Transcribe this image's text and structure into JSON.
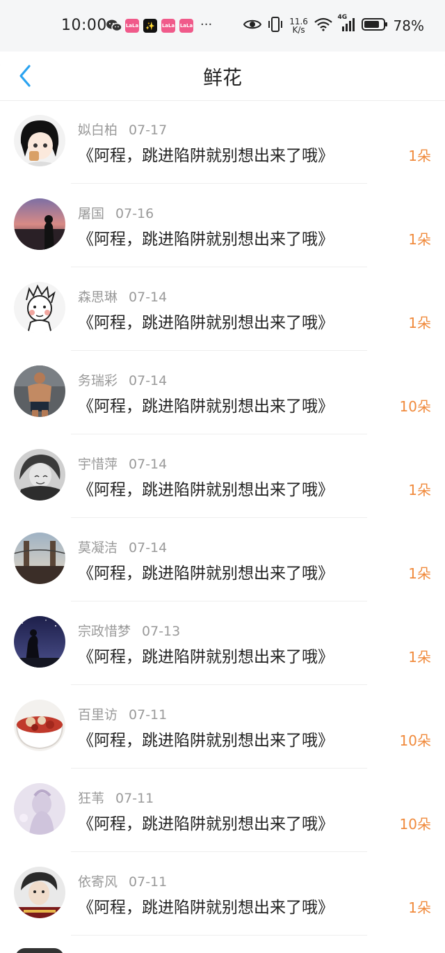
{
  "status_bar": {
    "time": "10:00",
    "notifications": [
      {
        "icon": "wechat-icon"
      },
      {
        "icon": "app-icon",
        "label": "LaLa"
      },
      {
        "icon": "app-icon-dark",
        "label": "✨"
      },
      {
        "icon": "app-icon",
        "label": "LaLa"
      },
      {
        "icon": "app-icon",
        "label": "LaLa"
      }
    ],
    "more": "···",
    "net_speed": "11.6",
    "net_speed_unit": "K/s",
    "network_type": "4G",
    "battery_percent": "78%"
  },
  "header": {
    "title": "鲜花",
    "back_icon": "chevron-left-icon",
    "accent_color": "#2aa3f0"
  },
  "colors": {
    "count": "#f08a3c",
    "meta": "#9a9a9a"
  },
  "items": [
    {
      "name": "姒白柏",
      "date": "07-17",
      "book": "《阿程，跳进陷阱就别想出来了哦》",
      "count": "1朵"
    },
    {
      "name": "屠国",
      "date": "07-16",
      "book": "《阿程，跳进陷阱就别想出来了哦》",
      "count": "1朵"
    },
    {
      "name": "森思琳",
      "date": "07-14",
      "book": "《阿程，跳进陷阱就别想出来了哦》",
      "count": "1朵"
    },
    {
      "name": "务瑞彩",
      "date": "07-14",
      "book": "《阿程，跳进陷阱就别想出来了哦》",
      "count": "10朵"
    },
    {
      "name": "宇惜萍",
      "date": "07-14",
      "book": "《阿程，跳进陷阱就别想出来了哦》",
      "count": "1朵"
    },
    {
      "name": "莫凝洁",
      "date": "07-14",
      "book": "《阿程，跳进陷阱就别想出来了哦》",
      "count": "1朵"
    },
    {
      "name": "宗政惜梦",
      "date": "07-13",
      "book": "《阿程，跳进陷阱就别想出来了哦》",
      "count": "1朵"
    },
    {
      "name": "百里访",
      "date": "07-11",
      "book": "《阿程，跳进陷阱就别想出来了哦》",
      "count": "10朵"
    },
    {
      "name": "狂苇",
      "date": "07-11",
      "book": "《阿程，跳进陷阱就别想出来了哦》",
      "count": "10朵"
    },
    {
      "name": "依寄风",
      "date": "07-11",
      "book": "《阿程，跳进陷阱就别想出来了哦》",
      "count": "1朵"
    }
  ]
}
